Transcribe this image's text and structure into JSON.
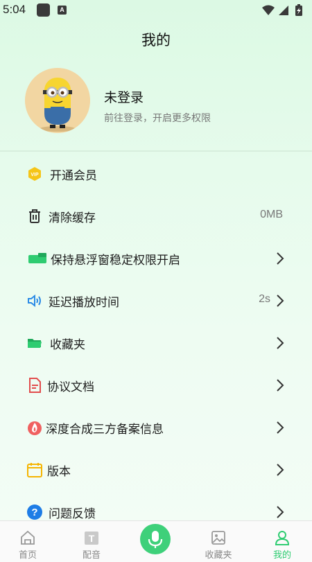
{
  "status_bar": {
    "time": "5:04",
    "notif_icon_a": "A"
  },
  "header": {
    "title": "我的"
  },
  "profile": {
    "name": "未登录",
    "subtitle": "前往登录，开启更多权限"
  },
  "menu": [
    {
      "icon": "vip-icon",
      "label": "开通会员",
      "value": "",
      "chevron": false
    },
    {
      "icon": "trash-icon",
      "label": "清除缓存",
      "value": "0MB",
      "chevron": false
    },
    {
      "icon": "floating-window-icon",
      "label": "保持悬浮窗稳定权限开启",
      "value": "",
      "chevron": true
    },
    {
      "icon": "speaker-icon",
      "label": "延迟播放时间",
      "value": "2s",
      "chevron": true
    },
    {
      "icon": "folder-icon",
      "label": "收藏夹",
      "value": "",
      "chevron": true
    },
    {
      "icon": "document-icon",
      "label": "协议文档",
      "value": "",
      "chevron": true
    },
    {
      "icon": "flame-icon",
      "label": "深度合成三方备案信息",
      "value": "",
      "chevron": true
    },
    {
      "icon": "calendar-icon",
      "label": "版本",
      "value": "",
      "chevron": true
    },
    {
      "icon": "question-icon",
      "label": "问题反馈",
      "value": "",
      "chevron": true
    }
  ],
  "tabs": [
    {
      "icon": "home-icon",
      "label": "首页"
    },
    {
      "icon": "dubbing-icon",
      "label": "配音"
    },
    {
      "icon": "mic-icon",
      "label": ""
    },
    {
      "icon": "favorites-icon",
      "label": "收藏夹"
    },
    {
      "icon": "profile-icon",
      "label": "我的"
    }
  ],
  "colors": {
    "accent": "#2ecc71",
    "mic_bg": "#3ed07a",
    "vip_gold": "#f5c518",
    "speaker_blue": "#2b8be6",
    "doc_red": "#e24c4c",
    "calendar_yellow": "#f5b400"
  }
}
